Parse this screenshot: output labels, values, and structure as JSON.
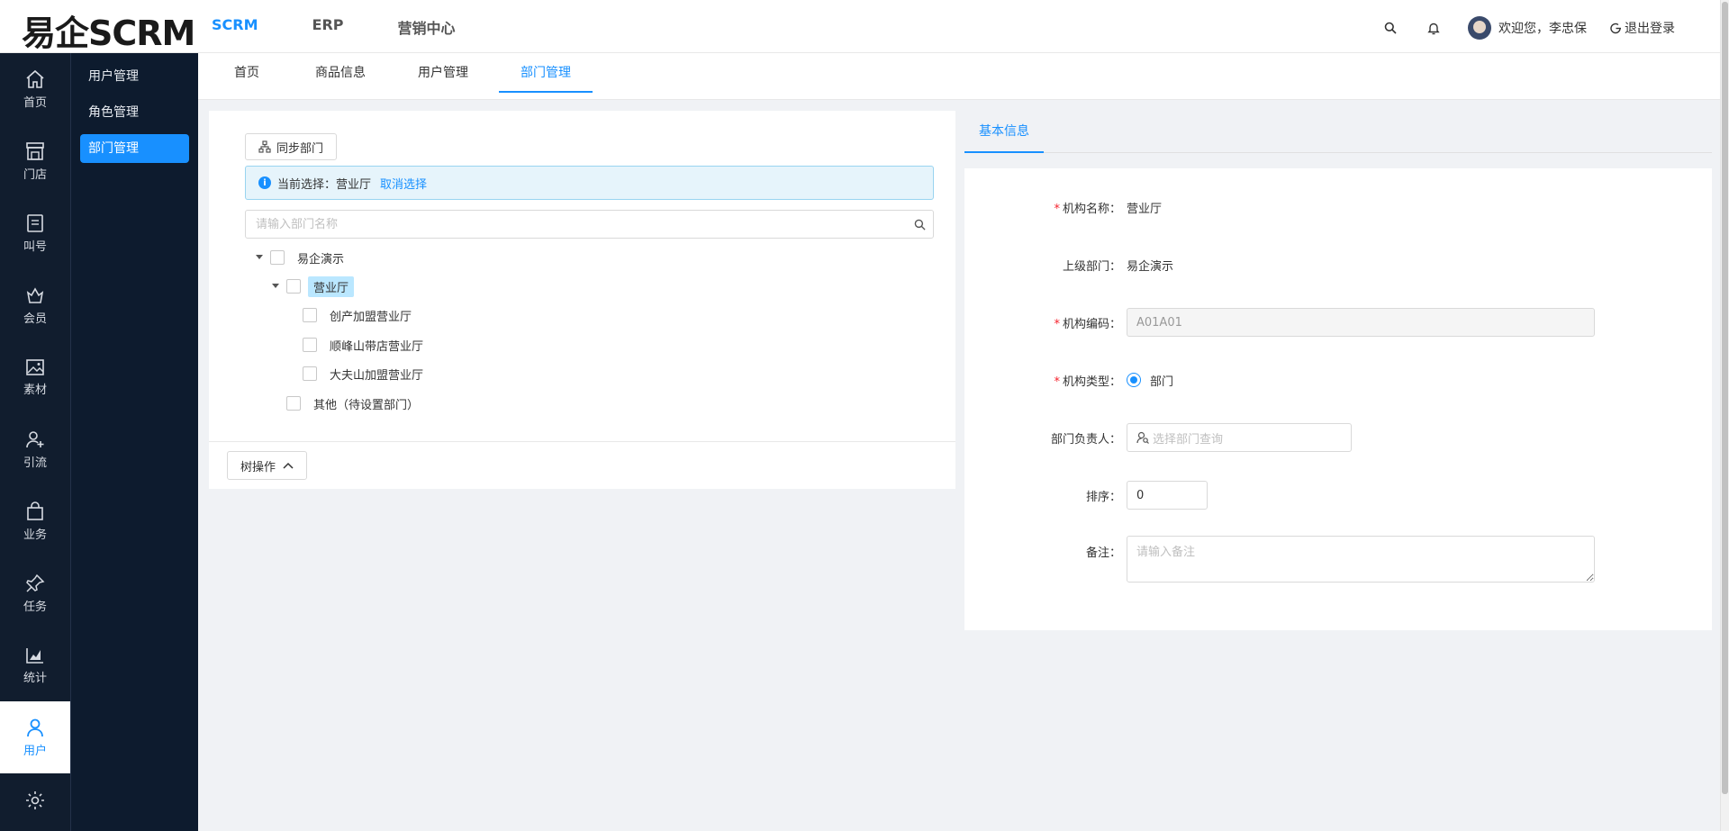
{
  "app": {
    "logo": "易企SCRM"
  },
  "topnav": {
    "items": [
      "SCRM",
      "ERP",
      "营销中心"
    ]
  },
  "header": {
    "welcome": "欢迎您，李忠保",
    "logout": "退出登录"
  },
  "icon_sidebar": {
    "items": [
      {
        "label": "首页",
        "icon": "home-icon"
      },
      {
        "label": "门店",
        "icon": "store-icon"
      },
      {
        "label": "叫号",
        "icon": "queue-icon"
      },
      {
        "label": "会员",
        "icon": "member-icon"
      },
      {
        "label": "素材",
        "icon": "image-icon"
      },
      {
        "label": "引流",
        "icon": "user-add-icon"
      },
      {
        "label": "业务",
        "icon": "shopping-bag-icon"
      },
      {
        "label": "任务",
        "icon": "pin-icon"
      },
      {
        "label": "统计",
        "icon": "chart-icon"
      },
      {
        "label": "用户",
        "icon": "user-icon"
      }
    ]
  },
  "sub_sidebar": {
    "items": [
      "用户管理",
      "角色管理",
      "部门管理"
    ]
  },
  "tabs": {
    "items": [
      "首页",
      "商品信息",
      "用户管理",
      "部门管理"
    ]
  },
  "left": {
    "sync_button": "同步部门",
    "current_prefix": "当前选择：",
    "current_value": "营业厅",
    "cancel_selection": "取消选择",
    "search_placeholder": "请输入部门名称",
    "tree": {
      "root": "易企演示",
      "n1": "营业厅",
      "n1_1": "创产加盟营业厅",
      "n1_2": "顺峰山带店营业厅",
      "n1_3": "大夫山加盟营业厅",
      "n2": "其他（待设置部门）"
    },
    "tree_ops_button": "树操作"
  },
  "right": {
    "tab": "基本信息",
    "fields": {
      "name_label": "机构名称：",
      "name_value": "营业厅",
      "parent_label": "上级部门：",
      "parent_value": "易企演示",
      "code_label": "机构编码：",
      "code_value": "A01A01",
      "type_label": "机构类型：",
      "type_value": "部门",
      "head_label": "部门负责人：",
      "head_placeholder": "选择部门查询",
      "sort_label": "排序：",
      "sort_value": "0",
      "remark_label": "备注：",
      "remark_placeholder": "请输入备注"
    }
  },
  "colors": {
    "primary": "#1890ff",
    "sidebar_bg": "#111d2e",
    "required": "#f5222d"
  }
}
